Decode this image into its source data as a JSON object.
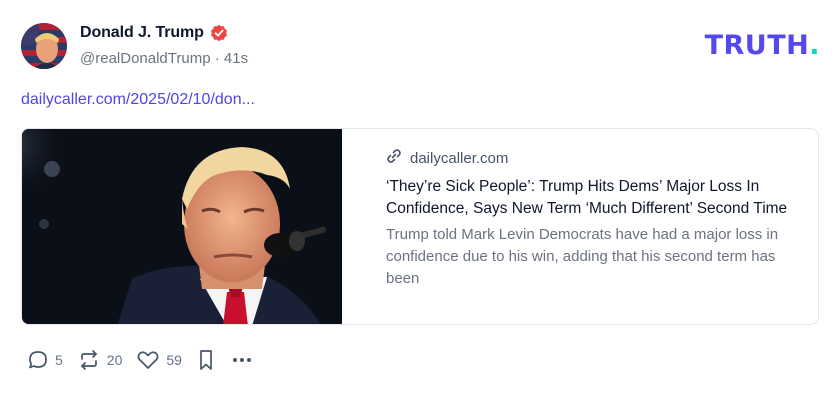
{
  "post": {
    "author_name": "Donald J. Trump",
    "handle": "@realDonaldTrump",
    "separator": "·",
    "time": "41s",
    "link_text": "dailycaller.com/2025/02/10/don..."
  },
  "brand": {
    "logo_text": "TRUTH",
    "logo_dot": ".",
    "accent_color": "#5448ee",
    "dot_color": "#17d3c2",
    "verified_color": "#ef4444"
  },
  "card": {
    "domain": "dailycaller.com",
    "headline": "‘They’re Sick People’: Trump Hits Dems’ Major Loss In Confidence, Says New Term ‘Much Different’ Second Time",
    "summary": "Trump told Mark Levin Democrats have had a major loss in confidence due to his win, adding that his second term has been"
  },
  "actions": {
    "replies": "5",
    "retruths": "20",
    "likes": "59"
  },
  "icons": [
    "verified-badge-icon",
    "link-icon",
    "reply-icon",
    "retruth-icon",
    "heart-icon",
    "bookmark-icon",
    "more-icon"
  ]
}
